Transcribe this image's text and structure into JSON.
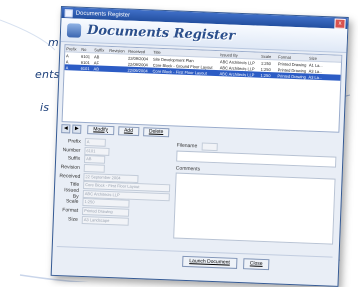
{
  "side_text": [
    "m",
    "ents",
    "is"
  ],
  "window": {
    "title": "Documents Register",
    "header_title": "Documents Register",
    "close_glyph": "x"
  },
  "grid": {
    "columns": [
      "Prefix",
      "No",
      "Suffix",
      "Revision",
      "Received",
      "Title",
      "Issued By",
      "Scale",
      "Format",
      "Size"
    ],
    "rows": [
      {
        "prefix": "A",
        "no": "6101",
        "suffix": "AB",
        "revision": "",
        "received": "22/09/2004",
        "title": "Site Development Plan",
        "issued_by": "ABC Architects LLP",
        "scale": "1:250",
        "format": "Printed Drawing",
        "size": "A1 La..."
      },
      {
        "prefix": "A",
        "no": "6101",
        "suffix": "AF",
        "revision": "",
        "received": "22/09/2004",
        "title": "Core Block - Ground Floor Layout",
        "issued_by": "ABC Architects LLP",
        "scale": "1:250",
        "format": "Printed Drawing",
        "size": "A3 La..."
      },
      {
        "prefix": "A",
        "no": "6101",
        "suffix": "AB",
        "revision": "",
        "received": "22/09/2004",
        "title": "Core Block - First Floor Layout",
        "issued_by": "ABC Architects LLP",
        "scale": "1:250",
        "format": "Printed Drawing",
        "size": "A3 La..."
      }
    ],
    "selected_row": 2
  },
  "toolbar": {
    "prev_glyph": "◀",
    "next_glyph": "▶",
    "modify_label": "Modify",
    "add_label": "Add",
    "delete_label": "Delete"
  },
  "form": {
    "prefix": {
      "label": "Prefix",
      "value": "A"
    },
    "number": {
      "label": "Number",
      "value": "6101"
    },
    "suffix": {
      "label": "Suffix",
      "value": "AB"
    },
    "revision": {
      "label": "Revision",
      "value": ""
    },
    "received": {
      "label": "Received",
      "value": "22 September 2004"
    },
    "title": {
      "label": "Title",
      "value": "Core Block - First Floor Layout"
    },
    "issued_by": {
      "label": "Issued By",
      "value": "ABC Architects LLP"
    },
    "scale": {
      "label": "Scale",
      "value": "1:250"
    },
    "format": {
      "label": "Format",
      "value": "Printed Drawing"
    },
    "size": {
      "label": "Size",
      "value": "A3 Landscape"
    }
  },
  "right": {
    "filename_label": "Filename",
    "comments_label": "Comments"
  },
  "buttons": {
    "launch_label": "Launch Document",
    "close_label": "Close"
  },
  "colors": {
    "accent": "#2c5cc5",
    "title_text": "#2b4f8c",
    "side_text": "#1c3f7a"
  }
}
